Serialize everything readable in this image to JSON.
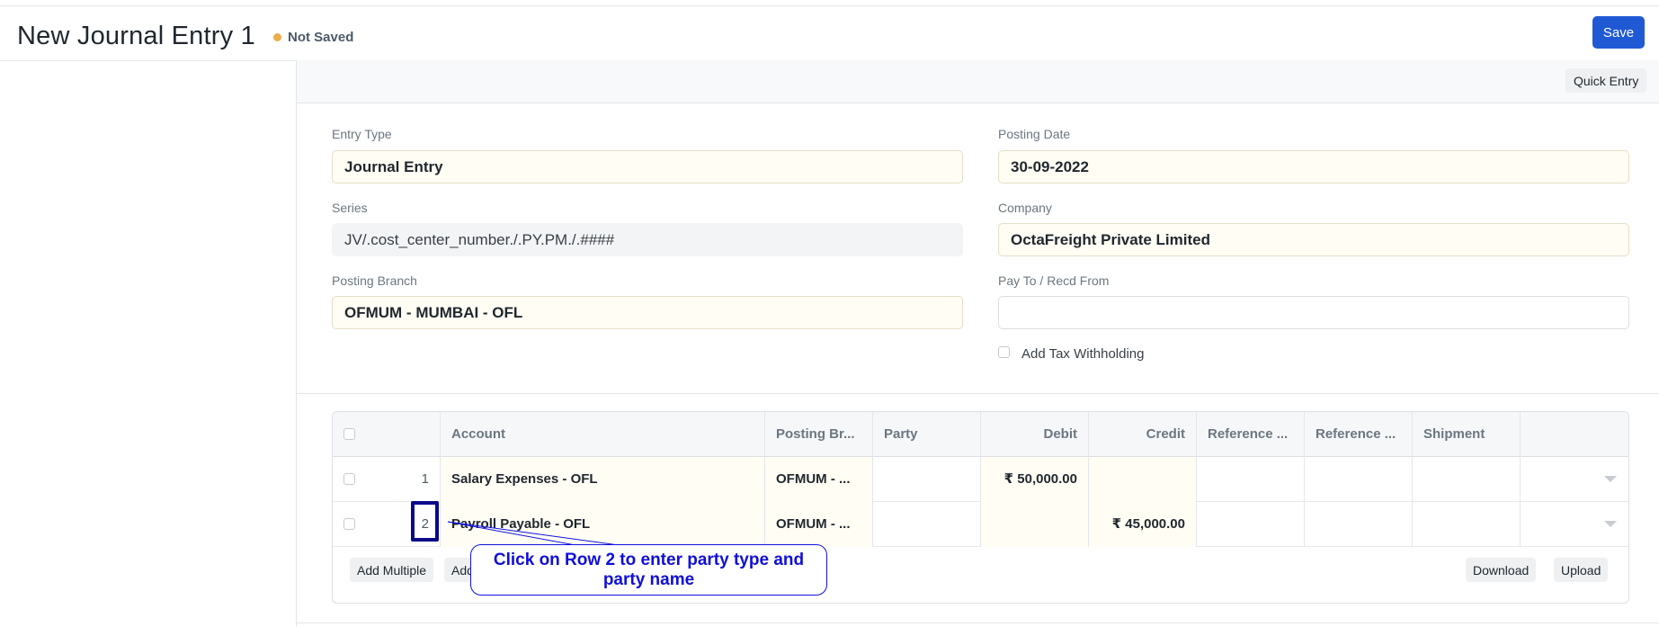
{
  "header": {
    "title": "New Journal Entry 1",
    "status": "Not Saved",
    "save_label": "Save"
  },
  "toolbar": {
    "quick_entry_label": "Quick Entry"
  },
  "fields": {
    "entry_type": {
      "label": "Entry Type",
      "value": "Journal Entry"
    },
    "series": {
      "label": "Series",
      "value": "JV/.cost_center_number./.PY.PM./.####"
    },
    "posting_branch": {
      "label": "Posting Branch",
      "value": "OFMUM - MUMBAI - OFL"
    },
    "posting_date": {
      "label": "Posting Date",
      "value": "30-09-2022"
    },
    "company": {
      "label": "Company",
      "value": "OctaFreight Private Limited"
    },
    "pay_to": {
      "label": "Pay To / Recd From",
      "value": ""
    },
    "add_tax_withholding": {
      "label": "Add Tax Withholding"
    }
  },
  "accounts_table": {
    "columns": [
      "Account",
      "Posting Br...",
      "Party",
      "Debit",
      "Credit",
      "Reference ...",
      "Reference ...",
      "Shipment"
    ],
    "rows": [
      {
        "idx": "1",
        "account": "Salary Expenses - OFL",
        "posting_branch": "OFMUM - ...",
        "party": "",
        "debit": "₹ 50,000.00",
        "credit": ""
      },
      {
        "idx": "2",
        "account": "Payroll Payable - OFL",
        "posting_branch": "OFMUM - ...",
        "party": "",
        "debit": "",
        "credit": "₹ 45,000.00"
      }
    ],
    "footer": {
      "add_multiple_label": "Add Multiple",
      "add_row_label": "Add",
      "download_label": "Download",
      "upload_label": "Upload"
    }
  },
  "annotation": {
    "tooltip_text": "Click on Row 2 to enter party type and party name"
  },
  "colors": {
    "primary": "#2059d4",
    "status_dot": "#ecad4b",
    "highlight": "#0a0a8a",
    "tooltip": "#0f0fd8"
  }
}
